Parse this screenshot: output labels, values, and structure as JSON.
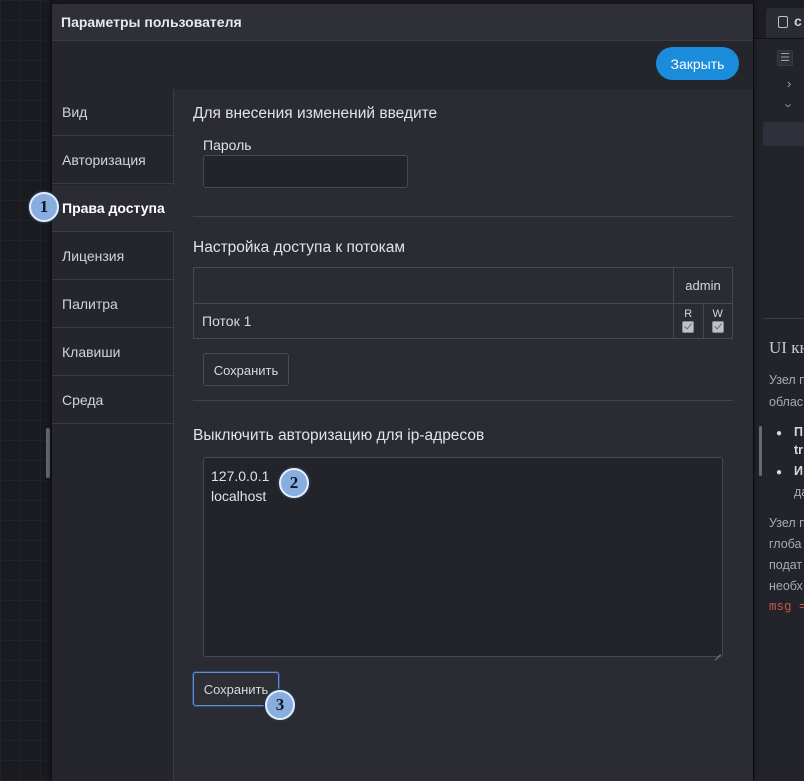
{
  "dialog": {
    "title": "Параметры пользователя",
    "close_label": "Закрыть"
  },
  "tabs": [
    {
      "label": "Вид"
    },
    {
      "label": "Авторизация"
    },
    {
      "label": "Права доступа",
      "active": true
    },
    {
      "label": "Лицензия"
    },
    {
      "label": "Палитра"
    },
    {
      "label": "Клавиши"
    },
    {
      "label": "Среда"
    }
  ],
  "auth_section": {
    "title": "Для внесения изменений введите",
    "password_label": "Пароль",
    "password_value": ""
  },
  "flows_section": {
    "title": "Настройка доступа к потокам",
    "users": [
      "admin"
    ],
    "permission_headers": [
      "R",
      "W"
    ],
    "rows": [
      {
        "flow": "Поток 1",
        "read": true,
        "write": true
      }
    ],
    "save_label": "Сохранить"
  },
  "ip_section": {
    "title": "Выключить авторизацию для ip-адресов",
    "addresses": [
      "127.0.0.1",
      "localhost"
    ],
    "save_label": "Сохранить"
  },
  "markers": [
    "1",
    "2",
    "3"
  ],
  "background_panel": {
    "tab_label": "с",
    "heading": "UI кн",
    "lines": [
      "Узел п",
      "облас"
    ],
    "bullets": [
      [
        "П",
        "tr"
      ],
      [
        "И",
        "да"
      ]
    ],
    "para": [
      "Узел п",
      "глоба",
      "подат",
      "необх"
    ],
    "code": "msg ="
  },
  "colors": {
    "accent": "#1a8cda",
    "marker": "#88aee0",
    "dialog_bg": "#2a2b33"
  }
}
